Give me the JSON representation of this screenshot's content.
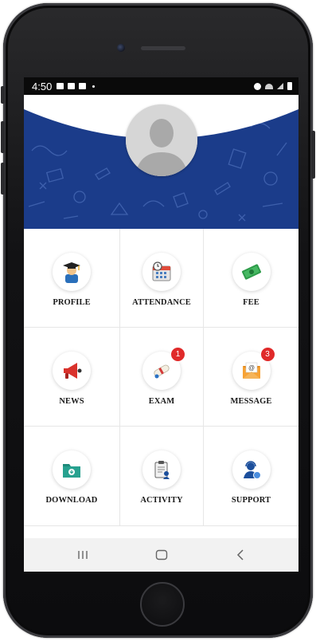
{
  "status_bar": {
    "time": "4:50"
  },
  "banner": {
    "theme_color": "#1b3c8a",
    "avatar_icon": "default-user-silhouette-icon"
  },
  "menu": [
    {
      "label": "PROFILE",
      "icon": "graduate-icon",
      "badge": ""
    },
    {
      "label": "ATTENDANCE",
      "icon": "calendar-clock-icon",
      "badge": ""
    },
    {
      "label": "FEE",
      "icon": "money-icon",
      "badge": ""
    },
    {
      "label": "NEWS",
      "icon": "megaphone-icon",
      "badge": ""
    },
    {
      "label": "EXAM",
      "icon": "diploma-icon",
      "badge": "1"
    },
    {
      "label": "MESSAGE",
      "icon": "envelope-icon",
      "badge": "3"
    },
    {
      "label": "DOWNLOAD",
      "icon": "download-folder-icon",
      "badge": ""
    },
    {
      "label": "ACTIVITY",
      "icon": "clipboard-icon",
      "badge": ""
    },
    {
      "label": "SUPPORT",
      "icon": "headset-agent-icon",
      "badge": ""
    }
  ],
  "nav_bar": {
    "recent_icon": "recent-apps-icon",
    "home_icon": "home-icon",
    "back_icon": "back-icon"
  },
  "colors": {
    "badge": "#e02a2a",
    "banner": "#1b3c8a"
  }
}
